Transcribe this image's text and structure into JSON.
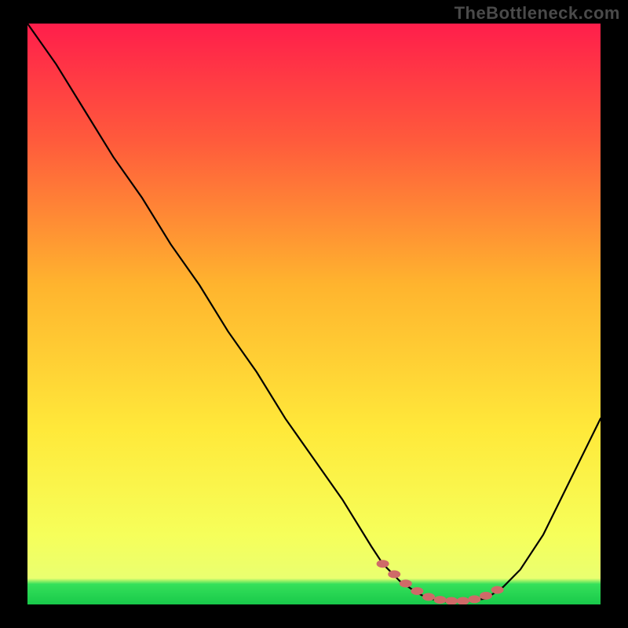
{
  "watermark": "TheBottleneck.com",
  "chart_data": {
    "type": "line",
    "title": "",
    "xlabel": "",
    "ylabel": "",
    "xlim": [
      0,
      100
    ],
    "ylim": [
      0,
      100
    ],
    "series": [
      {
        "name": "bottleneck-curve",
        "x": [
          0,
          5,
          10,
          15,
          20,
          25,
          30,
          35,
          40,
          45,
          50,
          55,
          60,
          62,
          65,
          68,
          70,
          73,
          76,
          80,
          83,
          86,
          90,
          94,
          98,
          100
        ],
        "values": [
          100,
          93,
          85,
          77,
          70,
          62,
          55,
          47,
          40,
          32,
          25,
          18,
          10,
          7,
          4,
          2,
          1,
          0.5,
          0.5,
          1,
          3,
          6,
          12,
          20,
          28,
          32
        ]
      }
    ],
    "markers": {
      "name": "highlight-dots",
      "x": [
        62,
        64,
        66,
        68,
        70,
        72,
        74,
        76,
        78,
        80,
        82
      ],
      "y": [
        7.0,
        5.2,
        3.6,
        2.3,
        1.3,
        0.8,
        0.6,
        0.6,
        0.9,
        1.5,
        2.5
      ],
      "color": "#cf6a68"
    },
    "gradient_stops": [
      {
        "offset": 0.0,
        "color": "#ff1e4b"
      },
      {
        "offset": 0.2,
        "color": "#ff5a3c"
      },
      {
        "offset": 0.45,
        "color": "#ffb42e"
      },
      {
        "offset": 0.7,
        "color": "#ffe93a"
      },
      {
        "offset": 0.88,
        "color": "#f6ff5a"
      },
      {
        "offset": 0.955,
        "color": "#eaff70"
      },
      {
        "offset": 0.965,
        "color": "#35e05a"
      },
      {
        "offset": 1.0,
        "color": "#18c94a"
      }
    ]
  }
}
